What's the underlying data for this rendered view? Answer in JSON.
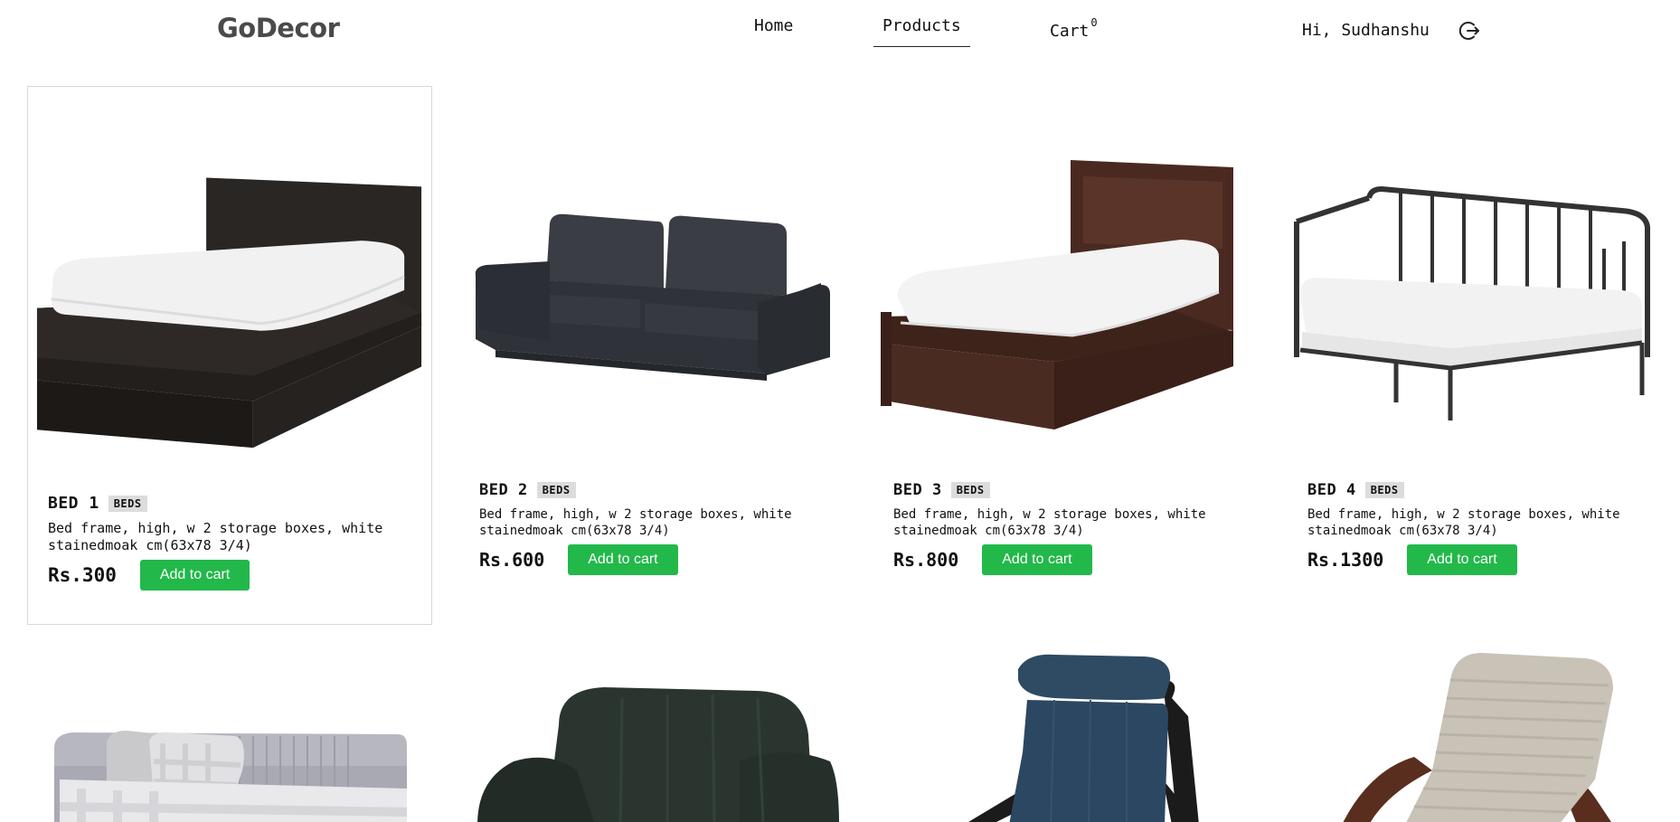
{
  "header": {
    "logo": "GoDecor",
    "nav": {
      "home": "Home",
      "products": "Products",
      "cart": "Cart",
      "cart_count": "0"
    },
    "greeting": "Hi, Sudhanshu"
  },
  "products": [
    {
      "name": "BED 1",
      "category": "BEDS",
      "description": "Bed frame, high, w 2 storage boxes, white stainedmoak cm(63x78 3/4)",
      "price": "Rs.300",
      "button": "Add to cart"
    },
    {
      "name": "BED 2",
      "category": "BEDS",
      "description": "Bed frame, high, w 2 storage boxes, white stainedmoak cm(63x78 3/4)",
      "price": "Rs.600",
      "button": "Add to cart"
    },
    {
      "name": "BED 3",
      "category": "BEDS",
      "description": "Bed frame, high, w 2 storage boxes, white stainedmoak cm(63x78 3/4)",
      "price": "Rs.800",
      "button": "Add to cart"
    },
    {
      "name": "BED 4",
      "category": "BEDS",
      "description": "Bed frame, high, w 2 storage boxes, white stainedmoak cm(63x78 3/4)",
      "price": "Rs.1300",
      "button": "Add to cart"
    }
  ],
  "colors": {
    "accent": "#22b84a",
    "logo": "#4a4a4a",
    "badge_bg": "#dcdcdc"
  },
  "icons": {
    "logout": "logout-icon"
  }
}
